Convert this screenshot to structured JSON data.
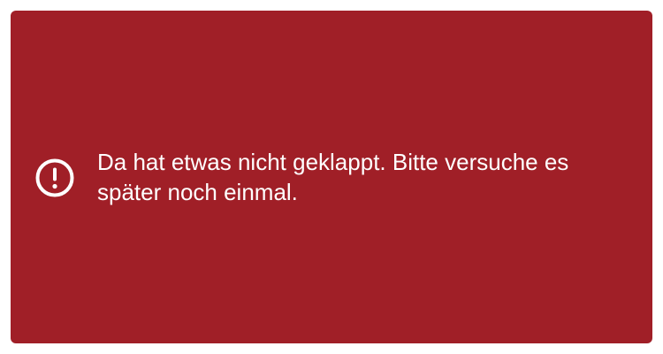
{
  "alert": {
    "icon": "exclamation-circle-icon",
    "message": "Da hat etwas nicht geklappt. Bitte versuche es später noch einmal.",
    "colors": {
      "background": "#a01f27",
      "foreground": "#ffffff"
    }
  }
}
